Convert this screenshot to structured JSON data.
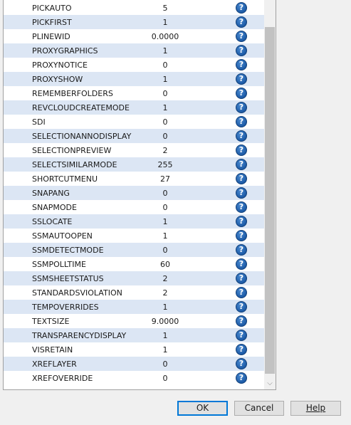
{
  "variables": [
    {
      "name": "PICKAUTO",
      "value": "5"
    },
    {
      "name": "PICKFIRST",
      "value": "1"
    },
    {
      "name": "PLINEWID",
      "value": "0.0000"
    },
    {
      "name": "PROXYGRAPHICS",
      "value": "1"
    },
    {
      "name": "PROXYNOTICE",
      "value": "0"
    },
    {
      "name": "PROXYSHOW",
      "value": "1"
    },
    {
      "name": "REMEMBERFOLDERS",
      "value": "0"
    },
    {
      "name": "REVCLOUDCREATEMODE",
      "value": "1"
    },
    {
      "name": "SDI",
      "value": "0"
    },
    {
      "name": "SELECTIONANNODISPLAY",
      "value": "0"
    },
    {
      "name": "SELECTIONPREVIEW",
      "value": "2"
    },
    {
      "name": "SELECTSIMILARMODE",
      "value": "255"
    },
    {
      "name": "SHORTCUTMENU",
      "value": "27"
    },
    {
      "name": "SNAPANG",
      "value": "0"
    },
    {
      "name": "SNAPMODE",
      "value": "0"
    },
    {
      "name": "SSLOCATE",
      "value": "1"
    },
    {
      "name": "SSMAUTOOPEN",
      "value": "1"
    },
    {
      "name": "SSMDETECTMODE",
      "value": "0"
    },
    {
      "name": "SSMPOLLTIME",
      "value": "60"
    },
    {
      "name": "SSMSHEETSTATUS",
      "value": "2"
    },
    {
      "name": "STANDARDSVIOLATION",
      "value": "2"
    },
    {
      "name": "TEMPOVERRIDES",
      "value": "1"
    },
    {
      "name": "TEXTSIZE",
      "value": "9.0000"
    },
    {
      "name": "TRANSPARENCYDISPLAY",
      "value": "1"
    },
    {
      "name": "VISRETAIN",
      "value": "1"
    },
    {
      "name": "XREFLAYER",
      "value": "0"
    },
    {
      "name": "XREFOVERRIDE",
      "value": "0"
    }
  ],
  "help_glyph": "?",
  "scroll_down_glyph": "⌵",
  "buttons": {
    "ok": "OK",
    "cancel": "Cancel",
    "help": "Help"
  },
  "colors": {
    "alt_row": "#dce6f4",
    "help_icon": "#1c5aa6",
    "default_button_border": "#0078d7"
  }
}
